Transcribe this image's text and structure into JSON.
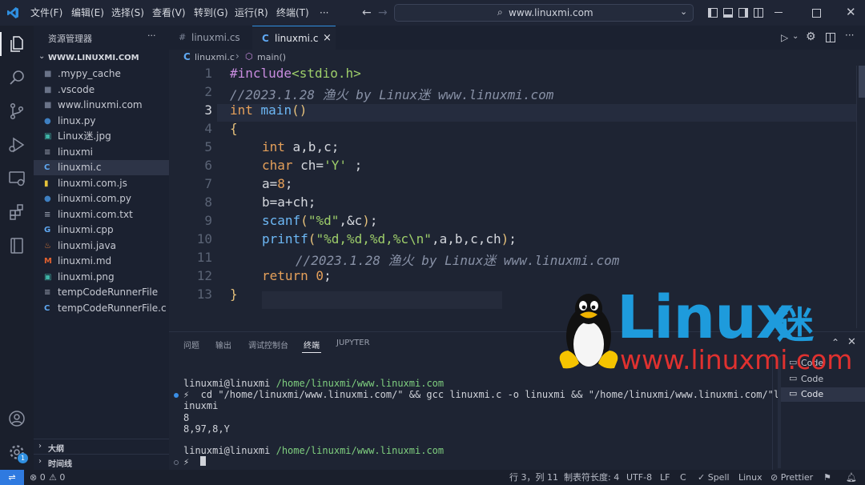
{
  "titlebar": {
    "menu": [
      "文件(F)",
      "编辑(E)",
      "选择(S)",
      "查看(V)",
      "转到(G)",
      "运行(R)",
      "终端(T)",
      "···"
    ],
    "search_text": "www.linuxmi.com"
  },
  "sidebar": {
    "title": "资源管理器",
    "more": "···",
    "root": "WWW.LINUXMI.COM",
    "items": [
      {
        "label": ".mypy_cache",
        "icon": "folder-icon"
      },
      {
        "label": ".vscode",
        "icon": "folder-icon"
      },
      {
        "label": "www.linuxmi.com",
        "icon": "folder-icon"
      },
      {
        "label": "linux.py",
        "icon": "python-icon"
      },
      {
        "label": "Linux迷.jpg",
        "icon": "image-icon"
      },
      {
        "label": "linuxmi",
        "icon": "file-icon"
      },
      {
        "label": "linuxmi.c",
        "icon": "c-icon"
      },
      {
        "label": "linuxmi.com.js",
        "icon": "js-icon"
      },
      {
        "label": "linuxmi.com.py",
        "icon": "python-icon"
      },
      {
        "label": "linuxmi.com.txt",
        "icon": "text-icon"
      },
      {
        "label": "linuxmi.cpp",
        "icon": "cpp-icon"
      },
      {
        "label": "linuxmi.java",
        "icon": "java-icon"
      },
      {
        "label": "linuxmi.md",
        "icon": "markdown-icon"
      },
      {
        "label": "linuxmi.png",
        "icon": "image-icon"
      },
      {
        "label": "tempCodeRunnerFile",
        "icon": "file-icon"
      },
      {
        "label": "tempCodeRunnerFile.c",
        "icon": "c-icon"
      }
    ],
    "outline": "大纲",
    "timeline": "时间线"
  },
  "tabs": [
    {
      "label": "linuxmi.cs",
      "icon": "#"
    },
    {
      "label": "linuxmi.c",
      "icon": "C",
      "close": "×"
    }
  ],
  "breadcrumb": {
    "file": "linuxmi.c",
    "symbol": "main()"
  },
  "code": {
    "line_numbers": [
      "1",
      "2",
      "3",
      "4",
      "5",
      "6",
      "7",
      "8",
      "9",
      "10",
      "11",
      "12",
      "13"
    ],
    "l1a": "#include",
    "l1b": "<stdio.h>",
    "l2": "//2023.1.28 渔火 by Linux迷 www.linuxmi.com",
    "l3a": "int",
    "l3b": " main",
    "l3c": "()",
    "l4": "{",
    "l5a": "int",
    "l5b": " a,b,c;",
    "l6a": "char",
    "l6b": " ch=",
    "l6c": "'Y'",
    "l6d": " ;",
    "l7a": "a=",
    "l7b": "8",
    "l7c": ";",
    "l8": "b=a+ch;",
    "l9a": "scanf",
    "l9b": "(",
    "l9c": "\"%d\"",
    "l9d": ",&c",
    "l9e": ")",
    "l9f": ";",
    "l10a": "printf",
    "l10b": "(",
    "l10c": "\"%d,%d,%d,%c\\n\"",
    "l10d": ",a,b,c,ch",
    "l10e": ")",
    "l10f": ";",
    "l11": "//2023.1.28 渔火 by Linux迷 www.linuxmi.com",
    "l12a": "return",
    "l12b": " 0",
    "l12c": ";",
    "l13": "}"
  },
  "panel": {
    "tabs": [
      "问题",
      "输出",
      "调试控制台",
      "终端",
      "JUPYTER"
    ],
    "active_tab": "终端",
    "terminal": {
      "p1_user": "linuxmi@linuxmi",
      "p1_path": " /home/linuxmi/www.linuxmi.com",
      "cmd_line1": "⚡  cd \"/home/linuxmi/www.linuxmi.com/\" && gcc linuxmi.c -o linuxmi && \"/home/linuxmi/www.linuxmi.com/\"l",
      "cmd_line2": "inuxmi",
      "out1": "8",
      "out2": "8,97,8,Y",
      "p2_user": "linuxmi@linuxmi",
      "p2_path": " /home/linuxmi/www.linuxmi.com",
      "prompt": "⚡"
    },
    "terminal_list": [
      "Code",
      "Code",
      "Code"
    ]
  },
  "watermark": {
    "logo": "Linux",
    "logo_cn": "迷",
    "url": "www.linuxmi.com"
  },
  "statusbar": {
    "branch_icon": "remote-icon",
    "errors": "⊗ 0",
    "warnings": "⚠ 0",
    "position": "行 3，列 11",
    "tab_size": "制表符长度: 4",
    "encoding": "UTF-8",
    "eol": "LF",
    "language": "C",
    "spell": "✓ Spell",
    "os": "Linux",
    "prettier": "⊘ Prettier"
  },
  "colors": {
    "accent": "#1e9bdc",
    "logo_red": "#e0312f",
    "background": "#1e2433"
  }
}
